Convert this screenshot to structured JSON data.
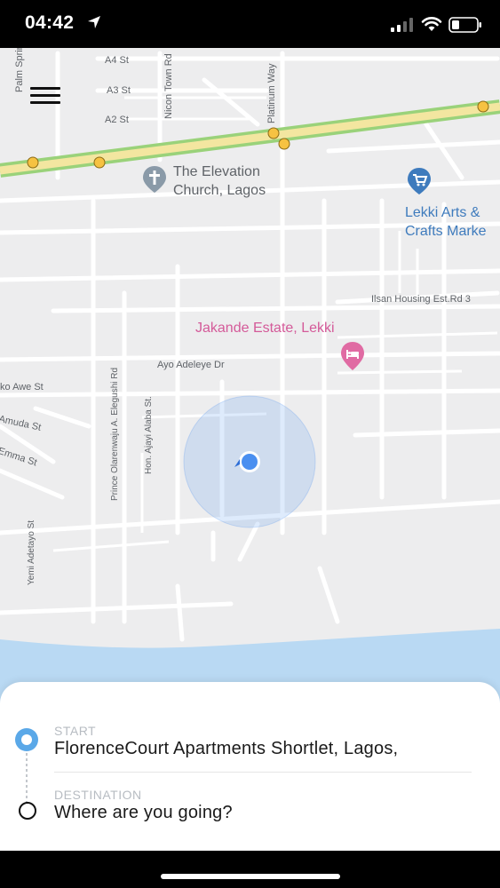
{
  "status_bar": {
    "time": "04:42"
  },
  "map": {
    "streets": {
      "a4": "A4 St",
      "a3": "A3 St",
      "a2": "A2 St",
      "palm": "Palm Springs Rd",
      "nicon": "Nicon Town Rd",
      "platinum": "Platinum Way",
      "ilsan": "Ilsan Housing Est.Rd 3",
      "ayo": "Ayo Adeleye Dr",
      "ko_awe": "ko Awe St",
      "amuda": "Amuda St",
      "emma": "Emma St",
      "prince": "Prince Olarenwaju A. Elegushi Rd",
      "ajayi": "Hon. Ajayi Alaba St.",
      "yemi": "Yemi Adetayo St"
    },
    "pois": {
      "church_line1": "The Elevation",
      "church_line2": "Church, Lagos",
      "market_line1": "Lekki Arts &",
      "market_line2": "Crafts Marke",
      "estate": "Jakande Estate, Lekki"
    },
    "colors": {
      "highway": "#9ad27a",
      "highway_core": "#f3e6a0",
      "water": "#b9d9f3",
      "location": "#4a8ff0"
    }
  },
  "sheet": {
    "start_label": "START",
    "start_value": "FlorenceCourt Apartments Shortlet, Lagos,",
    "destination_label": "DESTINATION",
    "destination_placeholder": "Where are you going?"
  }
}
